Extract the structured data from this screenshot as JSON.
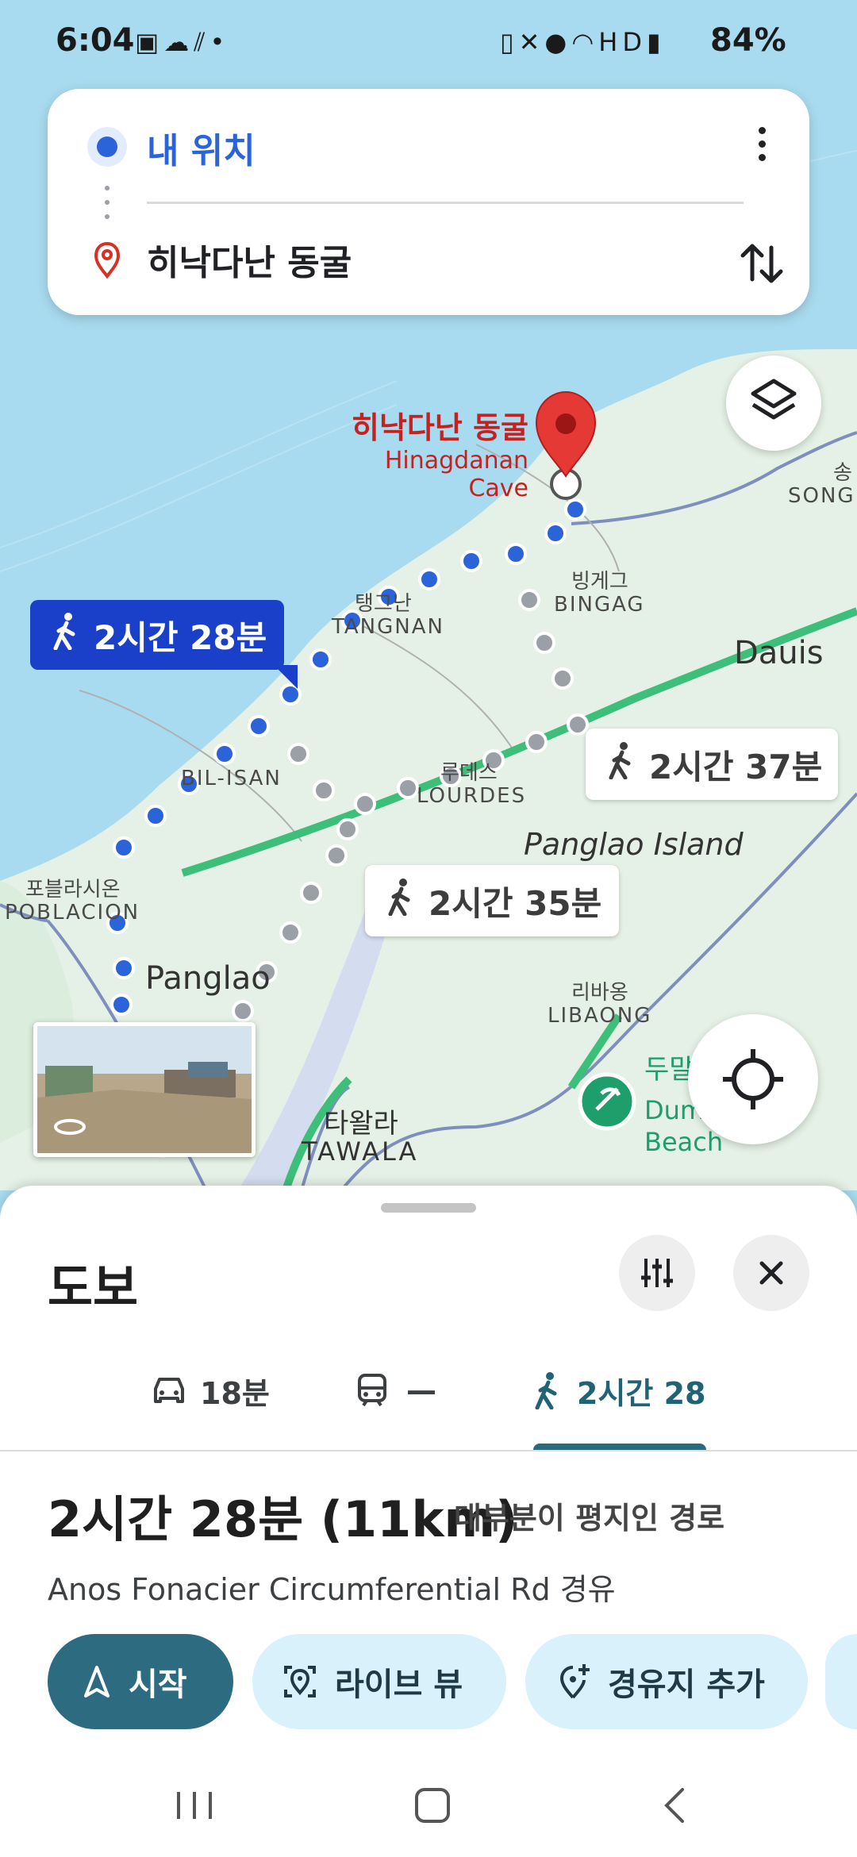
{
  "status": {
    "time": "6:04",
    "left_icons": [
      "image-icon",
      "weather-icon",
      "sync-icon",
      "dot-icon"
    ],
    "right_icons": [
      "battery-saver-icon",
      "mute-icon",
      "location-icon",
      "wifi-icon",
      "hd-voice-icon",
      "signal-icon"
    ],
    "battery": "84%"
  },
  "search": {
    "origin": "내 위치",
    "destination": "히낙다난 동굴"
  },
  "map": {
    "destination_label_ko": "히낙다난 동굴",
    "destination_label_en": "Hinagdanan Cave",
    "places": {
      "tangnan_ko": "탱그난",
      "tangnan_en": "TANGNAN",
      "bingag_ko": "빙게그",
      "bingag_en": "BINGAG",
      "dauis": "Dauis",
      "bilisan_en": "BIL-ISAN",
      "lourdes_ko": "루데스",
      "lourdes_en": "LOURDES",
      "panglao_island": "Panglao Island",
      "poblacion_ko": "포블라시온",
      "poblacion_en": "POBLACION",
      "panglao": "Panglao",
      "libaong_ko": "리바옹",
      "libaong_en": "LIBAONG",
      "tawala_ko": "타왈라",
      "tawala_en": "TAWALA",
      "song_ko": "송",
      "song_en": "SONG",
      "beach_ko": "두말",
      "beach_en1": "Dum",
      "beach_en2": "Beach"
    },
    "route_main": "2시간 28분",
    "route_alt1": "2시간 37분",
    "route_alt2": "2시간 35분"
  },
  "sheet": {
    "title": "도보",
    "tabs": [
      {
        "icon": "car-icon",
        "label": "18분"
      },
      {
        "icon": "transit-icon",
        "label": "—"
      },
      {
        "icon": "walk-icon",
        "label": "2시간 28"
      }
    ],
    "summary_time": "2시간 28분 (11km)",
    "summary_note": "대부분이 평지인 경로",
    "via": "Anos Fonacier Circumferential Rd 경유",
    "buttons": {
      "start": "시작",
      "live_view": "라이브 뷰",
      "add_waypoint": "경유지 추가"
    }
  },
  "colors": {
    "route_blue": "#2b63d9",
    "accent_teal": "#2c6b80",
    "chip_bg": "#d8f1fb",
    "pin_red": "#d93025"
  }
}
